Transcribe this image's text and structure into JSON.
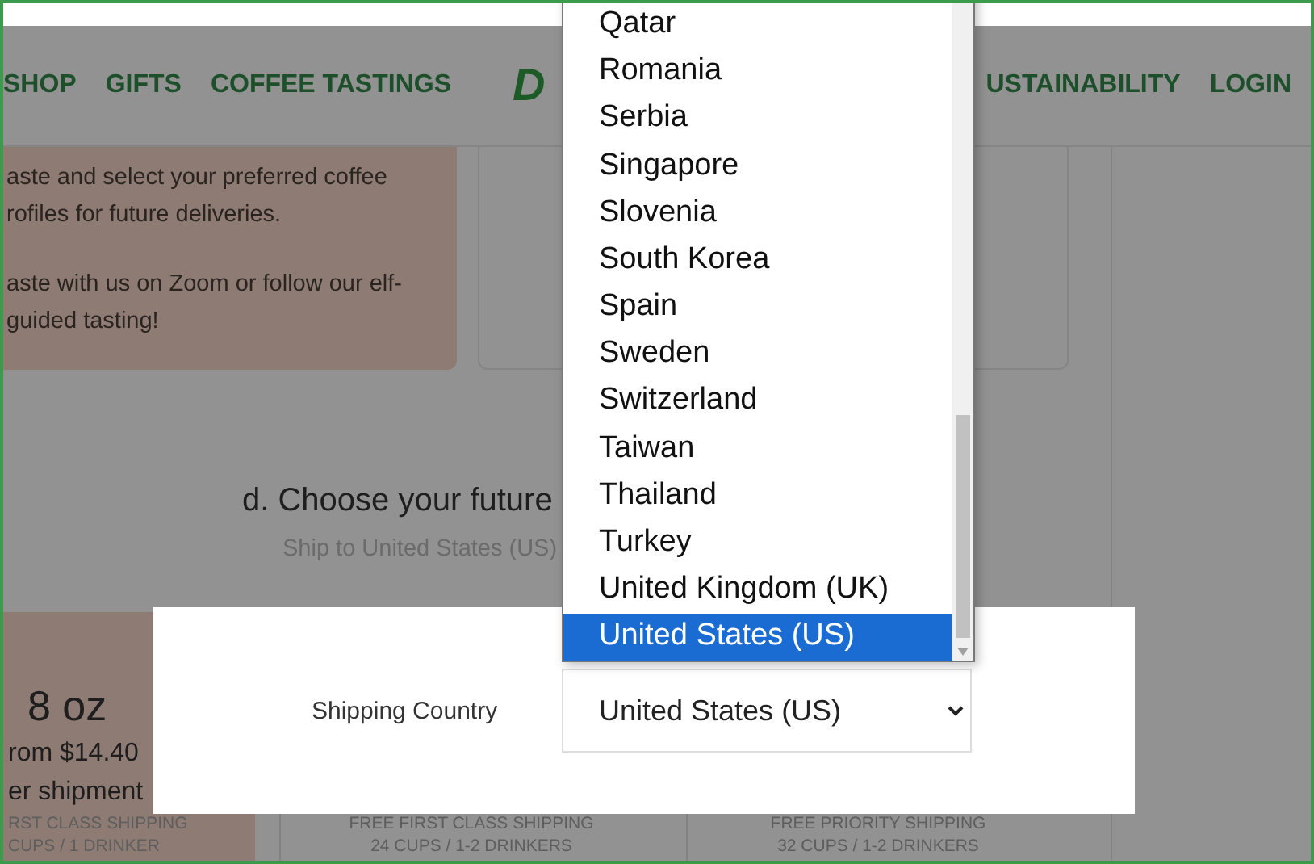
{
  "nav": {
    "left_items": [
      "SHOP",
      "GIFTS",
      "COFFEE TASTINGS"
    ],
    "logo": "D",
    "right_items": [
      "USTAINABILITY",
      "LOGIN"
    ]
  },
  "intro_card": {
    "paragraphs": [
      "aste and select your preferred coffee rofiles for future deliveries.",
      "aste with us on Zoom or follow our elf-guided tasting!"
    ]
  },
  "section": {
    "heading": "d. Choose your future",
    "subtitle": "Ship to United States (US)"
  },
  "plans": [
    {
      "size": "8 oz",
      "price": "rom $14.40",
      "per": "er shipment",
      "shipping": "RST CLASS SHIPPING",
      "cups": "CUPS / 1 DRINKER",
      "selected": true
    },
    {
      "shipping": "FREE FIRST CLASS SHIPPING",
      "cups": "24 CUPS / 1-2 DRINKERS",
      "selected": false
    },
    {
      "shipping": "FREE PRIORITY SHIPPING",
      "cups": "32 CUPS / 1-2 DRINKERS",
      "selected": false
    }
  ],
  "dialog": {
    "label": "Shipping Country",
    "value": "United States (US)"
  },
  "country_list": [
    {
      "label": "Qatar",
      "selected": false
    },
    {
      "label": "Romania",
      "selected": false
    },
    {
      "label": "Serbia",
      "selected": false
    },
    {
      "label": "Singapore",
      "selected": false
    },
    {
      "label": "Slovenia",
      "selected": false
    },
    {
      "label": "South Korea",
      "selected": false
    },
    {
      "label": "Spain",
      "selected": false
    },
    {
      "label": "Sweden",
      "selected": false
    },
    {
      "label": "Switzerland",
      "selected": false
    },
    {
      "label": "Taiwan",
      "selected": false
    },
    {
      "label": "Thailand",
      "selected": false
    },
    {
      "label": "Turkey",
      "selected": false
    },
    {
      "label": "United Kingdom (UK)",
      "selected": false
    },
    {
      "label": "United States (US)",
      "selected": true
    }
  ]
}
